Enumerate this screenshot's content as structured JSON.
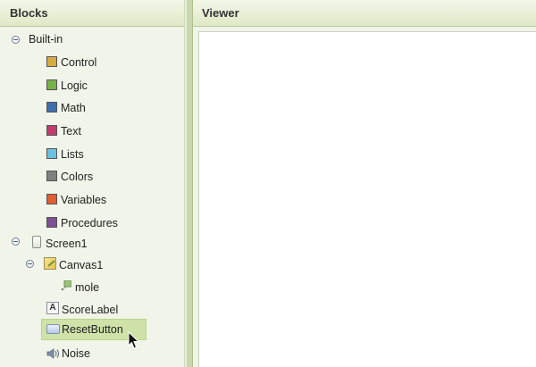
{
  "blocks_panel": {
    "title": "Blocks",
    "builtin": {
      "label": "Built-in",
      "items": [
        {
          "label": "Control",
          "color": "#d6ab42"
        },
        {
          "label": "Logic",
          "color": "#77b14a"
        },
        {
          "label": "Math",
          "color": "#3f6fae"
        },
        {
          "label": "Text",
          "color": "#c23b6f"
        },
        {
          "label": "Lists",
          "color": "#6cc0e0"
        },
        {
          "label": "Colors",
          "color": "#808080"
        },
        {
          "label": "Variables",
          "color": "#e15d34"
        },
        {
          "label": "Procedures",
          "color": "#7e4f92"
        }
      ]
    },
    "components": {
      "screen": "Screen1",
      "canvas": "Canvas1",
      "mole": "mole",
      "score_label": "ScoreLabel",
      "reset_button": "ResetButton",
      "noise": "Noise",
      "selected": "ResetButton"
    },
    "icons": {
      "collapse": "minus-circle-icon",
      "screen": "phone-screen-icon",
      "canvas": "canvas-icon",
      "sprite": "image-sprite-icon",
      "label": "label-A-icon",
      "button": "button-icon",
      "sound": "speaker-icon"
    }
  },
  "viewer_panel": {
    "title": "Viewer"
  },
  "colors": {
    "header_bg": "#e4ecd0",
    "panel_bg": "#f1f4e8",
    "selection": "#cfe3a8"
  }
}
